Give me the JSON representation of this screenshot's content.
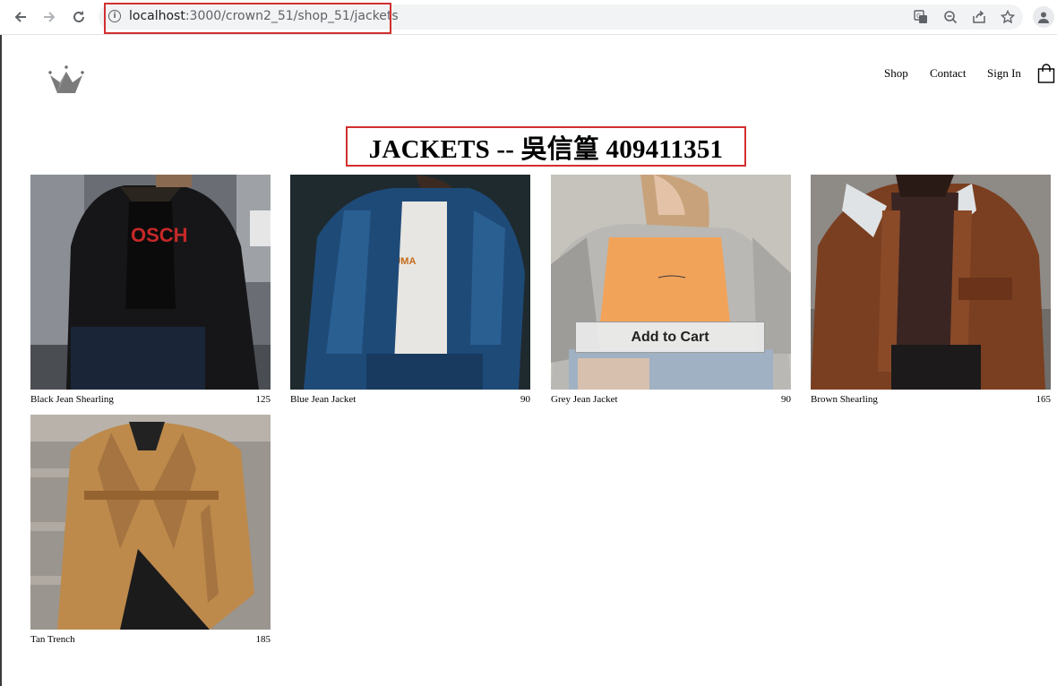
{
  "browser": {
    "url_host": "localhost",
    "url_path": ":3000/crown2_51/shop_51/jackets",
    "back_icon": "arrow-left-icon",
    "forward_icon": "arrow-right-icon",
    "reload_icon": "reload-icon",
    "info_icon": "info-icon",
    "translate_icon": "translate-icon",
    "zoom_icon": "zoom-out-icon",
    "share_icon": "share-icon",
    "bookmark_icon": "star-icon",
    "profile_icon": "profile-icon",
    "highlight_color": "#d32f2f"
  },
  "header": {
    "logo_icon": "crown-icon",
    "nav": [
      "Shop",
      "Contact",
      "Sign In"
    ],
    "cart_icon": "shopping-bag-icon"
  },
  "page": {
    "title": "JACKETS -- 吳信篁 409411351"
  },
  "products": [
    {
      "name": "Black Jean Shearling",
      "price": "125"
    },
    {
      "name": "Blue Jean Jacket",
      "price": "90"
    },
    {
      "name": "Grey Jean Jacket",
      "price": "90"
    },
    {
      "name": "Brown Shearling",
      "price": "165"
    },
    {
      "name": "Tan Trench",
      "price": "185"
    }
  ],
  "hover_button": {
    "label": "Add to Cart"
  }
}
